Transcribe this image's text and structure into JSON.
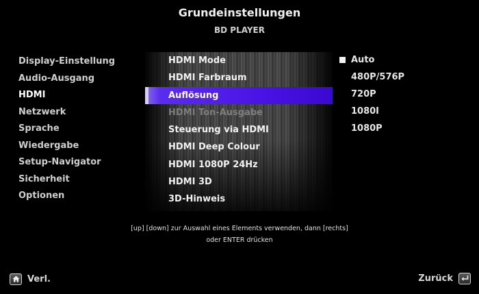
{
  "header": {
    "title": "Grundeinstellungen",
    "subtitle": "BD PLAYER"
  },
  "categories": [
    {
      "label": "Display-Einstellung"
    },
    {
      "label": "Audio-Ausgang"
    },
    {
      "label": "HDMI"
    },
    {
      "label": "Netzwerk"
    },
    {
      "label": "Sprache"
    },
    {
      "label": "Wiedergabe"
    },
    {
      "label": "Setup-Navigator"
    },
    {
      "label": "Sicherheit"
    },
    {
      "label": "Optionen"
    }
  ],
  "hdmi_menu": [
    {
      "label": "HDMI Mode"
    },
    {
      "label": "HDMI Farbraum"
    },
    {
      "label": "Auflösung"
    },
    {
      "label": "HDMI Ton-Ausgabe"
    },
    {
      "label": "Steuerung via HDMI"
    },
    {
      "label": "HDMI Deep Colour"
    },
    {
      "label": "HDMI 1080P 24Hz"
    },
    {
      "label": "HDMI 3D"
    },
    {
      "label": "3D-Hinweis"
    }
  ],
  "options": [
    {
      "label": "Auto"
    },
    {
      "label": "480P/576P"
    },
    {
      "label": "720P"
    },
    {
      "label": "1080I"
    },
    {
      "label": "1080P"
    }
  ],
  "hint": {
    "line1": "[up] [down] zur Auswahl eines Elements verwenden, dann [rechts]",
    "line2": "oder ENTER drücken"
  },
  "footer": {
    "home_label": "Verl.",
    "back_label": "Zurück"
  },
  "icons": {
    "home": "home-icon",
    "back": "return-icon"
  },
  "colors": {
    "highlight": "#4a14e6",
    "background": "#000000"
  }
}
